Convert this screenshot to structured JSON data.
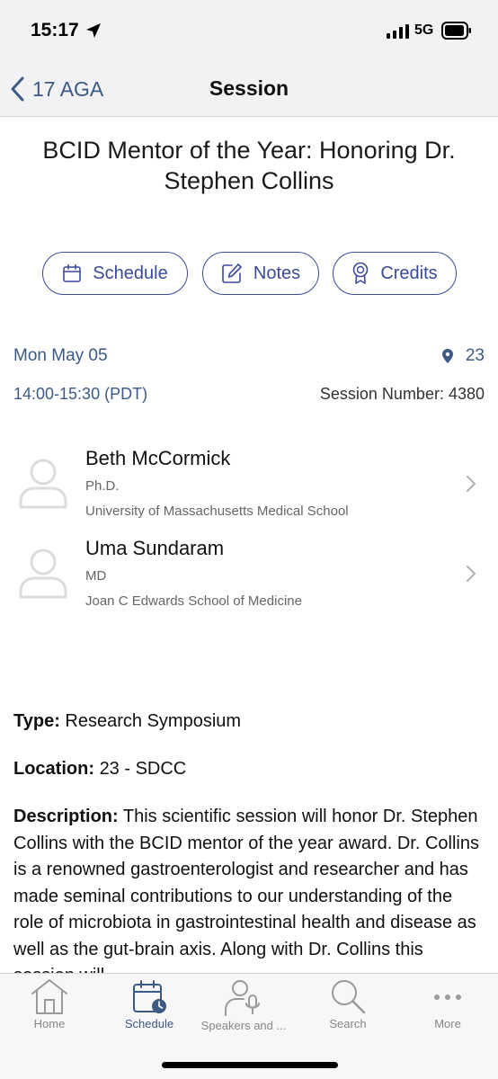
{
  "status_bar": {
    "time": "15:17",
    "network": "5G"
  },
  "nav": {
    "back_label": "17 AGA",
    "title": "Session"
  },
  "session": {
    "title": "BCID Mentor of the Year: Honoring Dr. Stephen Collins",
    "date": "Mon May 05",
    "room": "23",
    "time": "14:00-15:30 (PDT)",
    "session_number": "Session Number: 4380"
  },
  "actions": {
    "schedule": "Schedule",
    "notes": "Notes",
    "credits": "Credits"
  },
  "speakers": [
    {
      "name": "Beth McCormick",
      "degree": "Ph.D.",
      "organization": "University of Massachusetts Medical School"
    },
    {
      "name": "Uma Sundaram",
      "degree": "MD",
      "organization": "Joan C Edwards School of Medicine"
    }
  ],
  "details": {
    "type_label": "Type:",
    "type_value": "Research Symposium",
    "location_label": "Location:",
    "location_value": "23 - SDCC",
    "description_label": "Description:",
    "description_value": "This scientific session will honor Dr. Stephen Collins with the BCID mentor of the year award. Dr. Collins is a renowned gastroenterologist and researcher and has made seminal contributions to our understanding of the role of microbiota in gastrointestinal health and disease as well as the gut-brain axis. Along with Dr. Collins this session will"
  },
  "tabs": {
    "home": "Home",
    "schedule": "Schedule",
    "speakers": "Speakers and ...",
    "search": "Search",
    "more": "More"
  },
  "colors": {
    "accent": "#3b4a9a",
    "link": "#3c5a85",
    "muted": "#888888"
  }
}
